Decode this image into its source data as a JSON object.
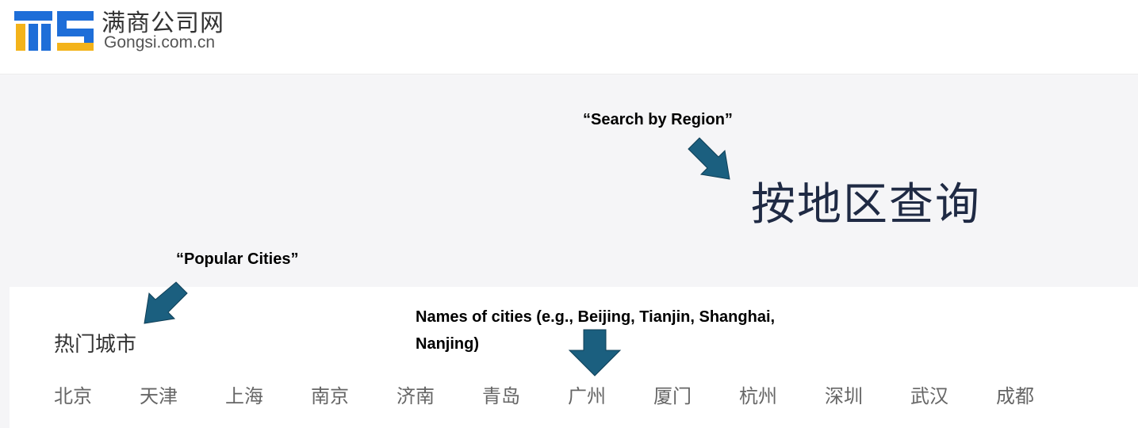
{
  "header": {
    "logo_title": "满商公司网",
    "logo_subtitle": "Gongsi.com.cn"
  },
  "region_heading": "按地区查询",
  "annotations": {
    "search_by_region": "“Search by Region”",
    "popular_cities": "“Popular Cities”",
    "city_names_line1": "Names of cities (e.g., Beijing, Tianjin, Shanghai,",
    "city_names_line2": "Nanjing)"
  },
  "hot_cities": {
    "title": "热门城市",
    "items": [
      "北京",
      "天津",
      "上海",
      "南京",
      "济南",
      "青岛",
      "广州",
      "厦门",
      "杭州",
      "深圳",
      "武汉",
      "成都"
    ]
  },
  "colors": {
    "arrow": "#1b5f7f",
    "logo_blue": "#1e6ed8",
    "logo_yellow": "#f3b31a",
    "heading": "#1f2a44"
  },
  "icons": {
    "logo": "ms-logo-mark",
    "annotation_arrow": "arrow-icon"
  }
}
